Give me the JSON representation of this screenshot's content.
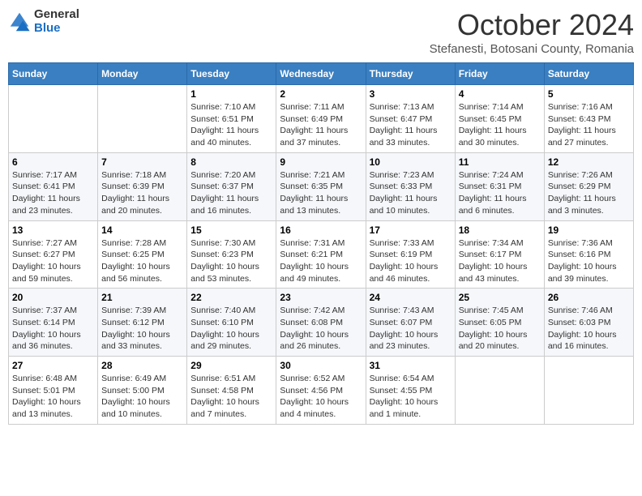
{
  "header": {
    "logo_general": "General",
    "logo_blue": "Blue",
    "month": "October 2024",
    "location": "Stefanesti, Botosani County, Romania"
  },
  "weekdays": [
    "Sunday",
    "Monday",
    "Tuesday",
    "Wednesday",
    "Thursday",
    "Friday",
    "Saturday"
  ],
  "weeks": [
    [
      {
        "day": "",
        "info": ""
      },
      {
        "day": "",
        "info": ""
      },
      {
        "day": "1",
        "info": "Sunrise: 7:10 AM\nSunset: 6:51 PM\nDaylight: 11 hours and 40 minutes."
      },
      {
        "day": "2",
        "info": "Sunrise: 7:11 AM\nSunset: 6:49 PM\nDaylight: 11 hours and 37 minutes."
      },
      {
        "day": "3",
        "info": "Sunrise: 7:13 AM\nSunset: 6:47 PM\nDaylight: 11 hours and 33 minutes."
      },
      {
        "day": "4",
        "info": "Sunrise: 7:14 AM\nSunset: 6:45 PM\nDaylight: 11 hours and 30 minutes."
      },
      {
        "day": "5",
        "info": "Sunrise: 7:16 AM\nSunset: 6:43 PM\nDaylight: 11 hours and 27 minutes."
      }
    ],
    [
      {
        "day": "6",
        "info": "Sunrise: 7:17 AM\nSunset: 6:41 PM\nDaylight: 11 hours and 23 minutes."
      },
      {
        "day": "7",
        "info": "Sunrise: 7:18 AM\nSunset: 6:39 PM\nDaylight: 11 hours and 20 minutes."
      },
      {
        "day": "8",
        "info": "Sunrise: 7:20 AM\nSunset: 6:37 PM\nDaylight: 11 hours and 16 minutes."
      },
      {
        "day": "9",
        "info": "Sunrise: 7:21 AM\nSunset: 6:35 PM\nDaylight: 11 hours and 13 minutes."
      },
      {
        "day": "10",
        "info": "Sunrise: 7:23 AM\nSunset: 6:33 PM\nDaylight: 11 hours and 10 minutes."
      },
      {
        "day": "11",
        "info": "Sunrise: 7:24 AM\nSunset: 6:31 PM\nDaylight: 11 hours and 6 minutes."
      },
      {
        "day": "12",
        "info": "Sunrise: 7:26 AM\nSunset: 6:29 PM\nDaylight: 11 hours and 3 minutes."
      }
    ],
    [
      {
        "day": "13",
        "info": "Sunrise: 7:27 AM\nSunset: 6:27 PM\nDaylight: 10 hours and 59 minutes."
      },
      {
        "day": "14",
        "info": "Sunrise: 7:28 AM\nSunset: 6:25 PM\nDaylight: 10 hours and 56 minutes."
      },
      {
        "day": "15",
        "info": "Sunrise: 7:30 AM\nSunset: 6:23 PM\nDaylight: 10 hours and 53 minutes."
      },
      {
        "day": "16",
        "info": "Sunrise: 7:31 AM\nSunset: 6:21 PM\nDaylight: 10 hours and 49 minutes."
      },
      {
        "day": "17",
        "info": "Sunrise: 7:33 AM\nSunset: 6:19 PM\nDaylight: 10 hours and 46 minutes."
      },
      {
        "day": "18",
        "info": "Sunrise: 7:34 AM\nSunset: 6:17 PM\nDaylight: 10 hours and 43 minutes."
      },
      {
        "day": "19",
        "info": "Sunrise: 7:36 AM\nSunset: 6:16 PM\nDaylight: 10 hours and 39 minutes."
      }
    ],
    [
      {
        "day": "20",
        "info": "Sunrise: 7:37 AM\nSunset: 6:14 PM\nDaylight: 10 hours and 36 minutes."
      },
      {
        "day": "21",
        "info": "Sunrise: 7:39 AM\nSunset: 6:12 PM\nDaylight: 10 hours and 33 minutes."
      },
      {
        "day": "22",
        "info": "Sunrise: 7:40 AM\nSunset: 6:10 PM\nDaylight: 10 hours and 29 minutes."
      },
      {
        "day": "23",
        "info": "Sunrise: 7:42 AM\nSunset: 6:08 PM\nDaylight: 10 hours and 26 minutes."
      },
      {
        "day": "24",
        "info": "Sunrise: 7:43 AM\nSunset: 6:07 PM\nDaylight: 10 hours and 23 minutes."
      },
      {
        "day": "25",
        "info": "Sunrise: 7:45 AM\nSunset: 6:05 PM\nDaylight: 10 hours and 20 minutes."
      },
      {
        "day": "26",
        "info": "Sunrise: 7:46 AM\nSunset: 6:03 PM\nDaylight: 10 hours and 16 minutes."
      }
    ],
    [
      {
        "day": "27",
        "info": "Sunrise: 6:48 AM\nSunset: 5:01 PM\nDaylight: 10 hours and 13 minutes."
      },
      {
        "day": "28",
        "info": "Sunrise: 6:49 AM\nSunset: 5:00 PM\nDaylight: 10 hours and 10 minutes."
      },
      {
        "day": "29",
        "info": "Sunrise: 6:51 AM\nSunset: 4:58 PM\nDaylight: 10 hours and 7 minutes."
      },
      {
        "day": "30",
        "info": "Sunrise: 6:52 AM\nSunset: 4:56 PM\nDaylight: 10 hours and 4 minutes."
      },
      {
        "day": "31",
        "info": "Sunrise: 6:54 AM\nSunset: 4:55 PM\nDaylight: 10 hours and 1 minute."
      },
      {
        "day": "",
        "info": ""
      },
      {
        "day": "",
        "info": ""
      }
    ]
  ]
}
